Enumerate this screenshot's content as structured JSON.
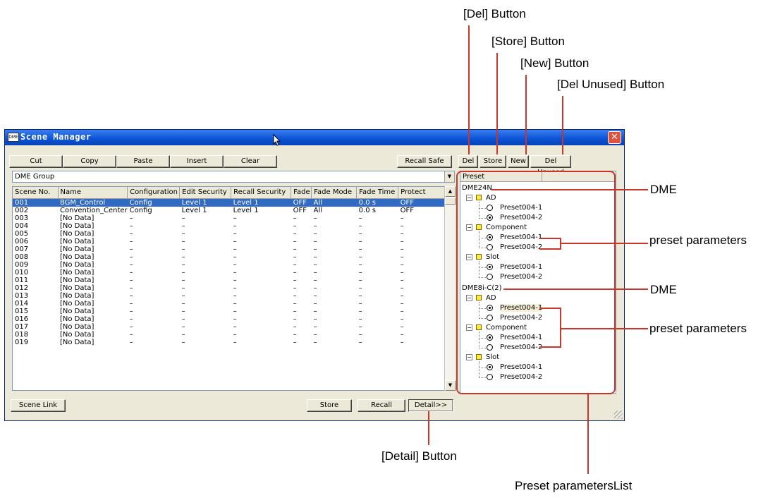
{
  "window": {
    "title": "Scene Manager"
  },
  "toolbar": {
    "cut": "Cut",
    "copy": "Copy",
    "paste": "Paste",
    "insert": "Insert",
    "clear": "Clear",
    "recall_safe": "Recall Safe",
    "del": "Del",
    "store": "Store",
    "new": "New",
    "del_unused": "Del Unused"
  },
  "group_combo": {
    "value": "DME Group"
  },
  "table": {
    "columns": [
      "Scene No.",
      "Name",
      "Configuration",
      "Edit Security",
      "Recall Security",
      "Fade",
      "Fade Mode",
      "Fade Time",
      "Protect"
    ],
    "rows": [
      [
        "001",
        "BGM_Control",
        "Config",
        "Level 1",
        "Level 1",
        "OFF",
        "All",
        "0.0 s",
        "OFF"
      ],
      [
        "002",
        "Convention_Center",
        "Config",
        "Level 1",
        "Level 1",
        "OFF",
        "All",
        "0.0 s",
        "OFF"
      ],
      [
        "003",
        "[No Data]",
        "–",
        "–",
        "–",
        "–",
        "–",
        "–",
        "–"
      ],
      [
        "004",
        "[No Data]",
        "–",
        "–",
        "–",
        "–",
        "–",
        "–",
        "–"
      ],
      [
        "005",
        "[No Data]",
        "–",
        "–",
        "–",
        "–",
        "–",
        "–",
        "–"
      ],
      [
        "006",
        "[No Data]",
        "–",
        "–",
        "–",
        "–",
        "–",
        "–",
        "–"
      ],
      [
        "007",
        "[No Data]",
        "–",
        "–",
        "–",
        "–",
        "–",
        "–",
        "–"
      ],
      [
        "008",
        "[No Data]",
        "–",
        "–",
        "–",
        "–",
        "–",
        "–",
        "–"
      ],
      [
        "009",
        "[No Data]",
        "–",
        "–",
        "–",
        "–",
        "–",
        "–",
        "–"
      ],
      [
        "010",
        "[No Data]",
        "–",
        "–",
        "–",
        "–",
        "–",
        "–",
        "–"
      ],
      [
        "011",
        "[No Data]",
        "–",
        "–",
        "–",
        "–",
        "–",
        "–",
        "–"
      ],
      [
        "012",
        "[No Data]",
        "–",
        "–",
        "–",
        "–",
        "–",
        "–",
        "–"
      ],
      [
        "013",
        "[No Data]",
        "–",
        "–",
        "–",
        "–",
        "–",
        "–",
        "–"
      ],
      [
        "014",
        "[No Data]",
        "–",
        "–",
        "–",
        "–",
        "–",
        "–",
        "–"
      ],
      [
        "015",
        "[No Data]",
        "–",
        "–",
        "–",
        "–",
        "–",
        "–",
        "–"
      ],
      [
        "016",
        "[No Data]",
        "–",
        "–",
        "–",
        "–",
        "–",
        "–",
        "–"
      ],
      [
        "017",
        "[No Data]",
        "–",
        "–",
        "–",
        "–",
        "–",
        "–",
        "–"
      ],
      [
        "018",
        "[No Data]",
        "–",
        "–",
        "–",
        "–",
        "–",
        "–",
        "–"
      ],
      [
        "019",
        "[No Data]",
        "–",
        "–",
        "–",
        "–",
        "–",
        "–",
        "–"
      ]
    ],
    "selected_row": 0
  },
  "bottom": {
    "scene_link": "Scene Link",
    "store": "Store",
    "recall": "Recall",
    "detail": "Detail>>"
  },
  "preset_panel": {
    "header": "Preset",
    "dme1": "DME24N",
    "dme2": "DME8i-C(2)",
    "folders": [
      "AD",
      "Component",
      "Slot"
    ],
    "preset_a": "Preset004-1",
    "preset_b": "Preset004-2"
  },
  "callouts": {
    "del": "[Del] Button",
    "store": "[Store] Button",
    "new": "[New] Button",
    "del_unused": "[Del Unused] Button",
    "dme": "DME",
    "preset_parameters": "preset parameters",
    "detail": "[Detail] Button",
    "preset_list": "Preset parametersList"
  },
  "colors": {
    "accent_red": "#c8372a",
    "selection_blue": "#316ac5",
    "title_blue": "#0a52d6"
  },
  "icons": [
    "app-icon",
    "close-icon",
    "cursor-icon",
    "folder-icon",
    "radio-icon"
  ]
}
